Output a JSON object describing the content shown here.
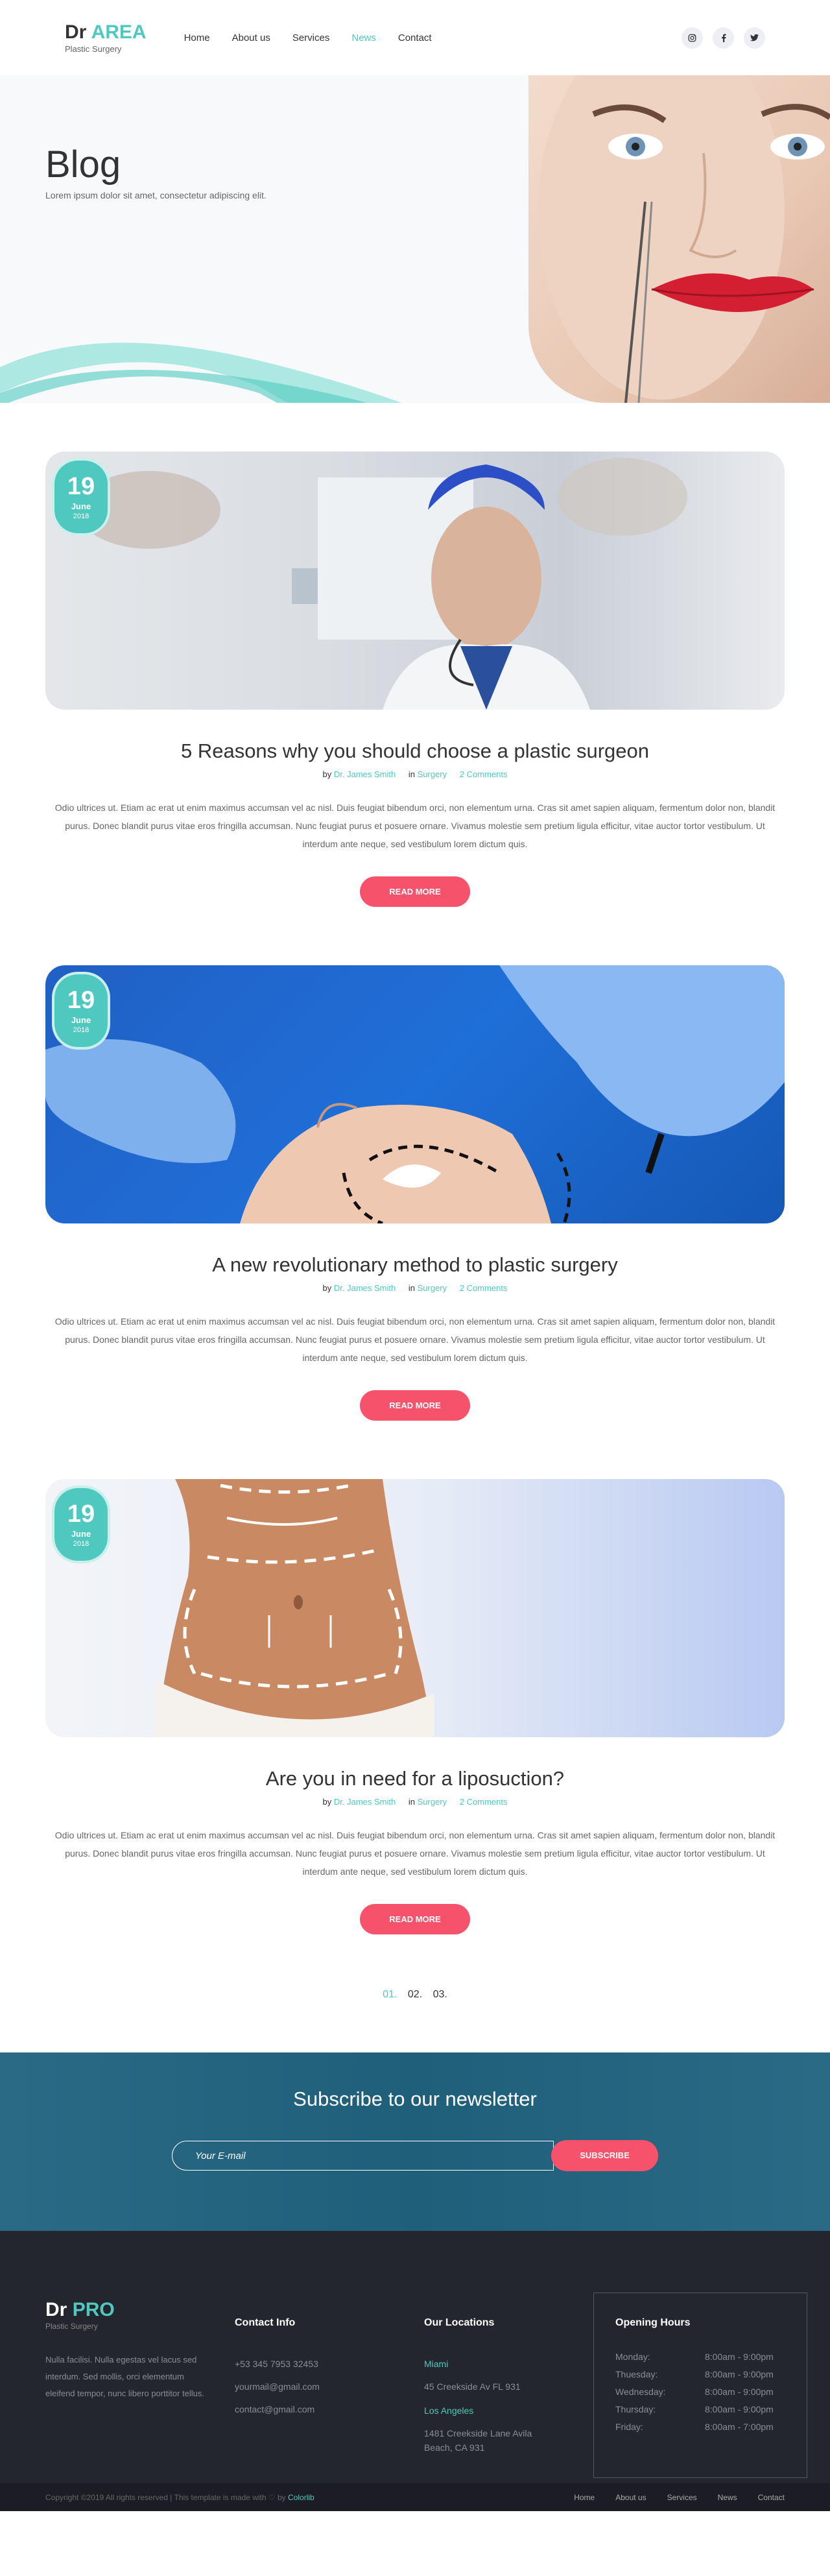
{
  "header": {
    "logo_main": "Dr",
    "logo_accent": "AREA",
    "logo_sub": "Plastic Surgery",
    "nav": [
      "Home",
      "About us",
      "Services",
      "News",
      "Contact"
    ],
    "active_nav": "News",
    "socials": [
      "instagram-icon",
      "facebook-icon",
      "twitter-icon"
    ]
  },
  "hero": {
    "title": "Blog",
    "subtitle": "Lorem ipsum dolor sit amet, consectetur adipiscing elit."
  },
  "posts": [
    {
      "day": "19",
      "month": "June",
      "year": "2018",
      "title": "5 Reasons why you should choose a plastic surgeon",
      "by": "by",
      "author": "Dr. James Smith",
      "in": "in",
      "category": "Surgery",
      "comments": "2 Comments",
      "excerpt": "Odio ultrices ut. Etiam ac erat ut enim maximus accumsan vel ac nisl. Duis feugiat bibendum orci, non elementum urna. Cras sit amet sapien aliquam, fermentum dolor non, blandit purus. Donec blandit purus vitae eros fringilla accumsan. Nunc feugiat purus et posuere ornare. Vivamus molestie sem pretium ligula efficitur, vitae auctor tortor vestibulum. Ut interdum ante neque, sed vestibulum lorem dictum quis.",
      "button": "READ MORE"
    },
    {
      "day": "19",
      "month": "June",
      "year": "2018",
      "title": "A new revolutionary method to plastic surgery",
      "by": "by",
      "author": "Dr. James Smith",
      "in": "in",
      "category": "Surgery",
      "comments": "2 Comments",
      "excerpt": "Odio ultrices ut. Etiam ac erat ut enim maximus accumsan vel ac nisl. Duis feugiat bibendum orci, non elementum urna. Cras sit amet sapien aliquam, fermentum dolor non, blandit purus. Donec blandit purus vitae eros fringilla accumsan. Nunc feugiat purus et posuere ornare. Vivamus molestie sem pretium ligula efficitur, vitae auctor tortor vestibulum. Ut interdum ante neque, sed vestibulum lorem dictum quis.",
      "button": "READ MORE"
    },
    {
      "day": "19",
      "month": "June",
      "year": "2018",
      "title": "Are you in need for a liposuction?",
      "by": "by",
      "author": "Dr. James Smith",
      "in": "in",
      "category": "Surgery",
      "comments": "2 Comments",
      "excerpt": "Odio ultrices ut. Etiam ac erat ut enim maximus accumsan vel ac nisl. Duis feugiat bibendum orci, non elementum urna. Cras sit amet sapien aliquam, fermentum dolor non, blandit purus. Donec blandit purus vitae eros fringilla accumsan. Nunc feugiat purus et posuere ornare. Vivamus molestie sem pretium ligula efficitur, vitae auctor tortor vestibulum. Ut interdum ante neque, sed vestibulum lorem dictum quis.",
      "button": "READ MORE"
    }
  ],
  "pagination": [
    "01.",
    "02.",
    "03."
  ],
  "newsletter": {
    "title": "Subscribe to our newsletter",
    "placeholder": "Your E-mail",
    "button": "SUBSCRIBE"
  },
  "footer": {
    "logo_main": "Dr",
    "logo_accent": "PRO",
    "logo_sub": "Plastic Surgery",
    "about": "Nulla facilisi. Nulla egestas vel lacus sed interdum. Sed mollis, orci elementum eleifend tempor, nunc libero porttitor tellus.",
    "contact": {
      "heading": "Contact Info",
      "phone": "+53 345 7953 32453",
      "email1": "yourmail@gmail.com",
      "email2": "contact@gmail.com"
    },
    "locations": {
      "heading": "Our Locations",
      "city1": "Miami",
      "addr1": "45 Creekside Av FL 931",
      "city2": "Los Angeles",
      "addr2": "1481 Creekside Lane Avila Beach, CA 931"
    },
    "hours": {
      "heading": "Opening Hours",
      "rows": [
        {
          "day": "Monday:",
          "time": "8:00am - 9:00pm"
        },
        {
          "day": "Thuesday:",
          "time": "8:00am - 9:00pm"
        },
        {
          "day": "Wednesday:",
          "time": "8:00am - 9:00pm"
        },
        {
          "day": "Thursday:",
          "time": "8:00am - 9:00pm"
        },
        {
          "day": "Friday:",
          "time": "8:00am - 7:00pm"
        }
      ]
    },
    "copyright_prefix": "Copyright ©2019 All rights reserved | This template is made with ♡ by",
    "copyright_brand": "Colorlib",
    "nav": [
      "Home",
      "About us",
      "Services",
      "News",
      "Contact"
    ]
  }
}
